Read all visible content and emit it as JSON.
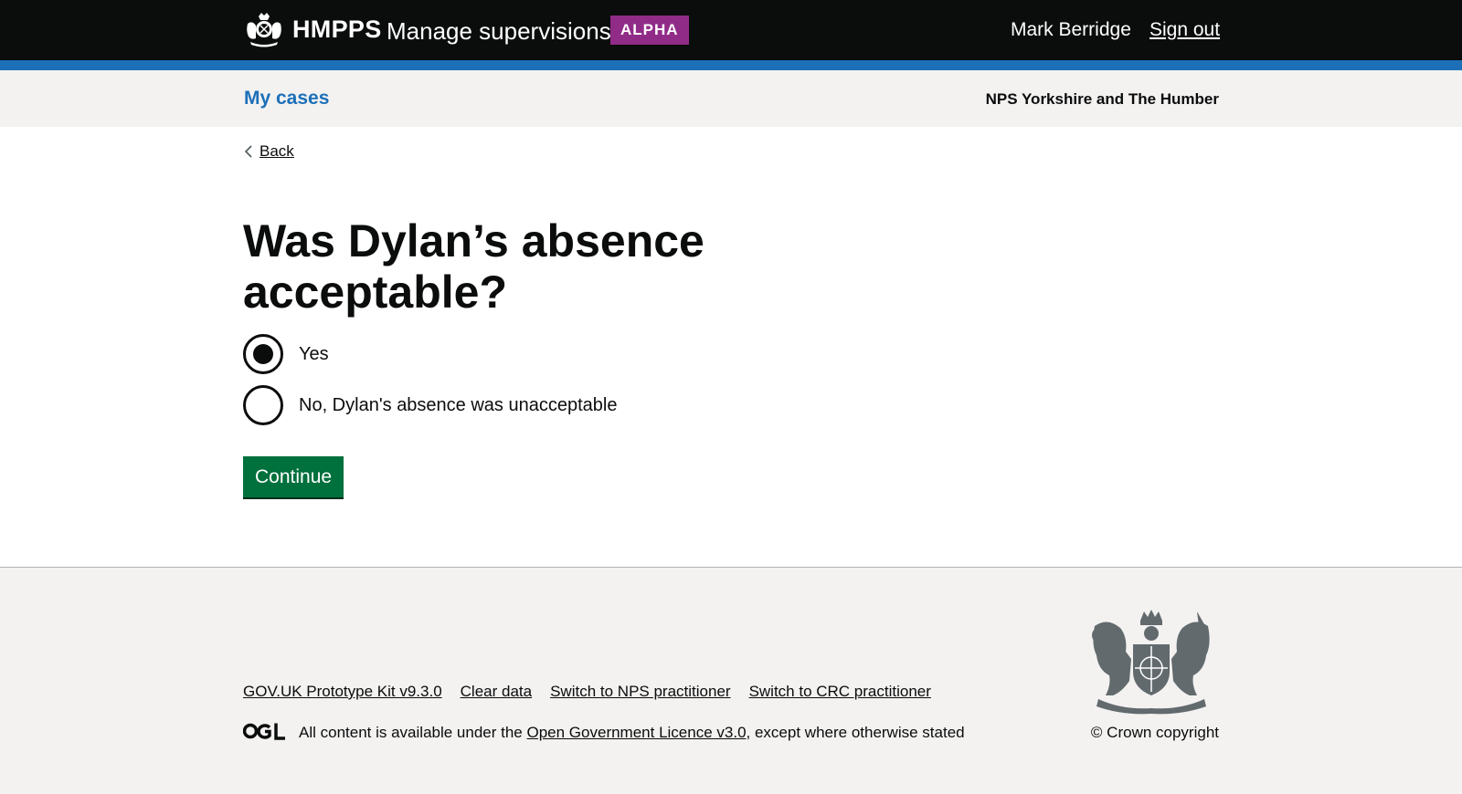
{
  "header": {
    "brand": "HMPPS",
    "service": "Manage supervisions",
    "phase": "ALPHA",
    "user": "Mark Berridge",
    "sign_out": "Sign out"
  },
  "subnav": {
    "my_cases": "My cases",
    "region": "NPS Yorkshire and The Humber"
  },
  "back": "Back",
  "question": {
    "heading": "Was Dylan’s absence acceptable?",
    "options": [
      {
        "label": "Yes",
        "selected": true
      },
      {
        "label": "No, Dylan's absence was unacceptable",
        "selected": false
      }
    ]
  },
  "continue": "Continue",
  "footer": {
    "links": [
      "GOV.UK Prototype Kit v9.3.0",
      "Clear data",
      "Switch to NPS practitioner",
      "Switch to CRC practitioner"
    ],
    "licence_prefix": "All content is available under the ",
    "licence_link": "Open Government Licence v3.0",
    "licence_suffix": ", except where otherwise stated",
    "copyright": "© Crown copyright"
  },
  "colors": {
    "header_bg": "#0b0c0c",
    "header_bar": "#1d70b8",
    "phase_tag": "#912b88",
    "link": "#1d70b8",
    "button": "#00703c",
    "footer_bg": "#f3f2f1"
  },
  "icons": [
    "crown-crest-icon",
    "back-chevron-icon",
    "ogl-logo-icon",
    "royal-coat-of-arms-icon"
  ]
}
